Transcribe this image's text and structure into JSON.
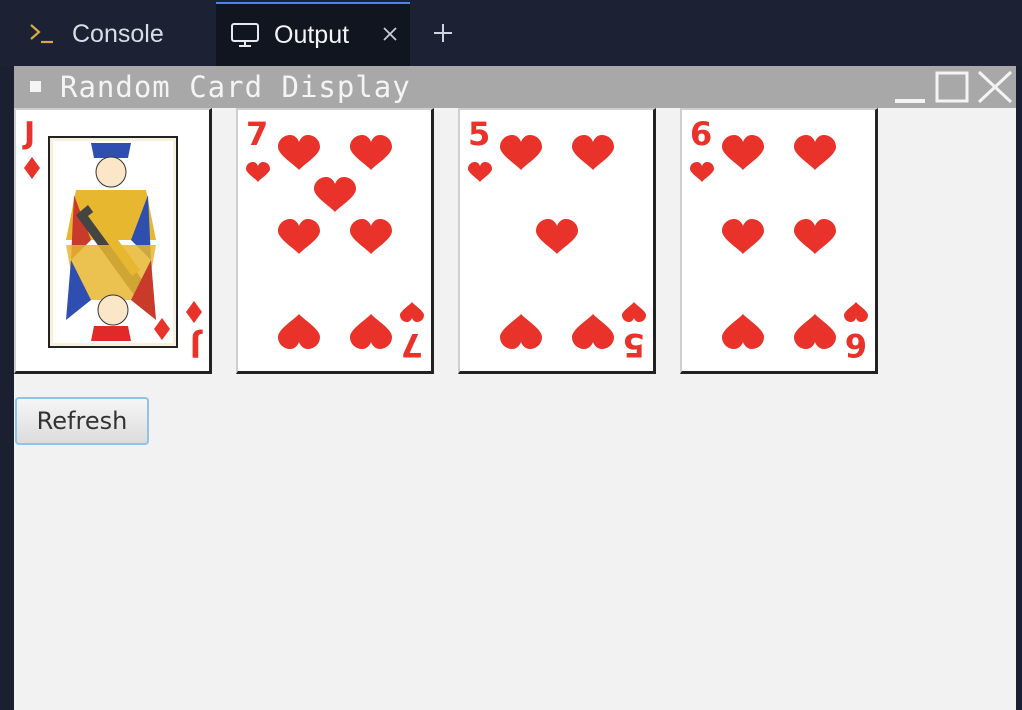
{
  "tabs": [
    {
      "label": "Console",
      "icon": "terminal-icon",
      "active": false
    },
    {
      "label": "Output",
      "icon": "monitor-icon",
      "active": true,
      "close_icon": "close-icon"
    }
  ],
  "add_tab_icon": "plus-icon",
  "window": {
    "title": "Random Card Display",
    "controls": [
      "minimize-icon",
      "maximize-icon",
      "close-icon"
    ]
  },
  "cards": [
    {
      "rank": "J",
      "suit": "diamonds",
      "color": "#e8322a"
    },
    {
      "rank": "7",
      "suit": "hearts",
      "color": "#e8322a"
    },
    {
      "rank": "5",
      "suit": "hearts",
      "color": "#e8322a"
    },
    {
      "rank": "6",
      "suit": "hearts",
      "color": "#e8322a"
    }
  ],
  "refresh_label": "Refresh"
}
